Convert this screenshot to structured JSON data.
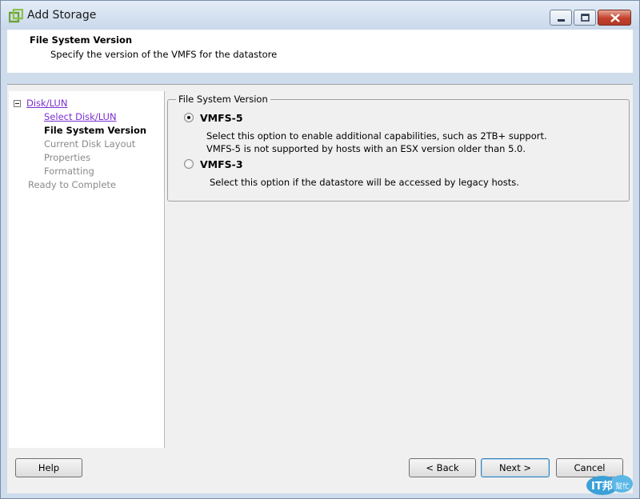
{
  "window": {
    "title": "Add Storage",
    "icon": "vmware-logo-icon"
  },
  "header": {
    "title": "File System Version",
    "subtitle": "Specify the version of the VMFS for the datastore"
  },
  "nav": {
    "items": [
      {
        "label": "Disk/LUN",
        "state": "link"
      },
      {
        "label": "Select Disk/LUN",
        "state": "link"
      },
      {
        "label": "File System Version",
        "state": "current"
      },
      {
        "label": "Current Disk Layout",
        "state": "disabled"
      },
      {
        "label": "Properties",
        "state": "disabled"
      },
      {
        "label": "Formatting",
        "state": "disabled"
      },
      {
        "label": "Ready to Complete",
        "state": "disabled"
      }
    ]
  },
  "content": {
    "group_title": "File System Version",
    "options": [
      {
        "label": "VMFS-5",
        "selected": true,
        "desc_line1": "Select this option to enable additional capabilities, such as 2TB+ support.",
        "desc_line2": "VMFS-5 is not supported by hosts with an ESX version older than 5.0."
      },
      {
        "label": "VMFS-3",
        "selected": false,
        "desc_line1": "Select this option if the datastore will be accessed by legacy hosts."
      }
    ]
  },
  "footer": {
    "help": "Help",
    "back": "< Back",
    "next": "Next >",
    "cancel": "Cancel"
  },
  "watermark": {
    "text_main": "IT邦",
    "text_sub": "幫忙"
  },
  "colors": {
    "link": "#7a2fd0",
    "titlebar": "#c9d8ea",
    "close": "#c2402c"
  }
}
